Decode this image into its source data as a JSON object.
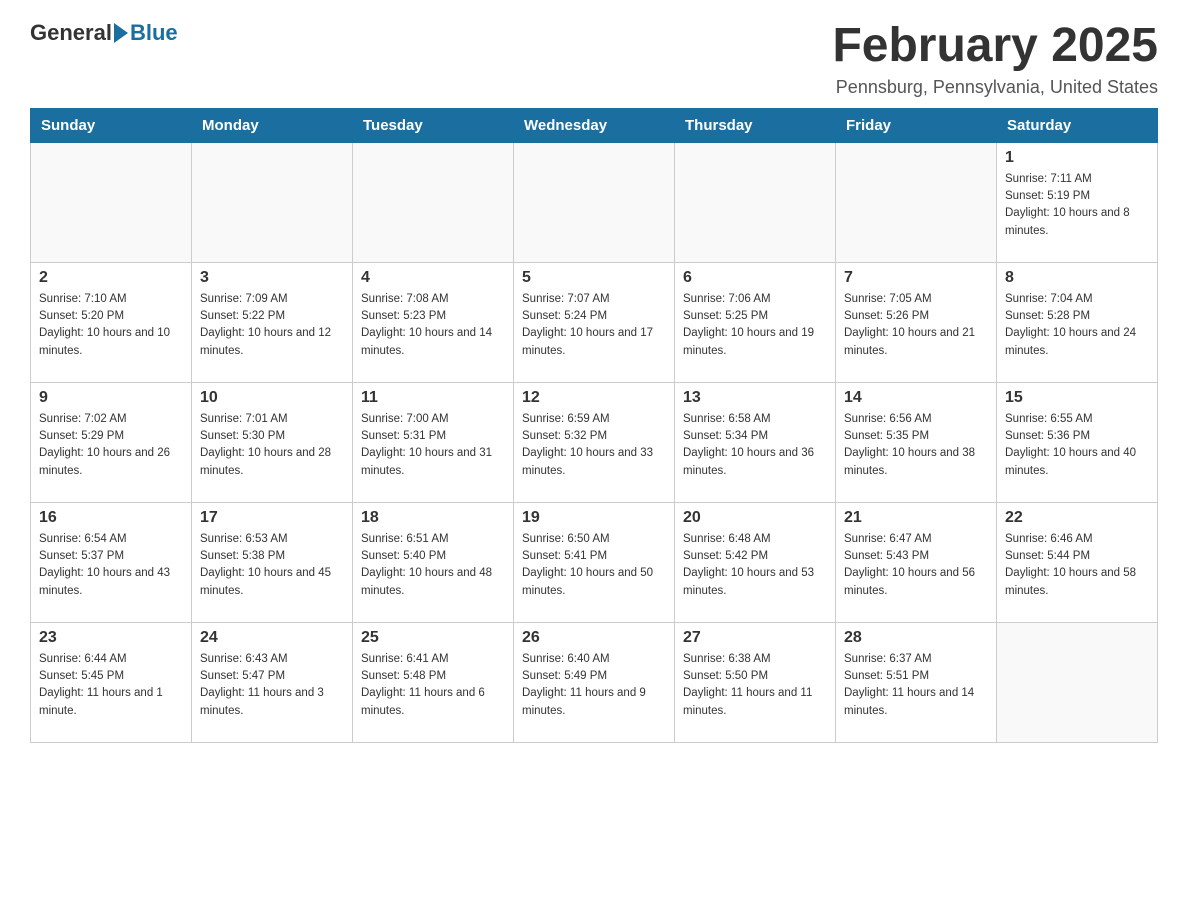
{
  "logo": {
    "general": "General",
    "blue": "Blue"
  },
  "title": "February 2025",
  "subtitle": "Pennsburg, Pennsylvania, United States",
  "days_of_week": [
    "Sunday",
    "Monday",
    "Tuesday",
    "Wednesday",
    "Thursday",
    "Friday",
    "Saturday"
  ],
  "weeks": [
    [
      {
        "day": "",
        "info": ""
      },
      {
        "day": "",
        "info": ""
      },
      {
        "day": "",
        "info": ""
      },
      {
        "day": "",
        "info": ""
      },
      {
        "day": "",
        "info": ""
      },
      {
        "day": "",
        "info": ""
      },
      {
        "day": "1",
        "info": "Sunrise: 7:11 AM\nSunset: 5:19 PM\nDaylight: 10 hours and 8 minutes."
      }
    ],
    [
      {
        "day": "2",
        "info": "Sunrise: 7:10 AM\nSunset: 5:20 PM\nDaylight: 10 hours and 10 minutes."
      },
      {
        "day": "3",
        "info": "Sunrise: 7:09 AM\nSunset: 5:22 PM\nDaylight: 10 hours and 12 minutes."
      },
      {
        "day": "4",
        "info": "Sunrise: 7:08 AM\nSunset: 5:23 PM\nDaylight: 10 hours and 14 minutes."
      },
      {
        "day": "5",
        "info": "Sunrise: 7:07 AM\nSunset: 5:24 PM\nDaylight: 10 hours and 17 minutes."
      },
      {
        "day": "6",
        "info": "Sunrise: 7:06 AM\nSunset: 5:25 PM\nDaylight: 10 hours and 19 minutes."
      },
      {
        "day": "7",
        "info": "Sunrise: 7:05 AM\nSunset: 5:26 PM\nDaylight: 10 hours and 21 minutes."
      },
      {
        "day": "8",
        "info": "Sunrise: 7:04 AM\nSunset: 5:28 PM\nDaylight: 10 hours and 24 minutes."
      }
    ],
    [
      {
        "day": "9",
        "info": "Sunrise: 7:02 AM\nSunset: 5:29 PM\nDaylight: 10 hours and 26 minutes."
      },
      {
        "day": "10",
        "info": "Sunrise: 7:01 AM\nSunset: 5:30 PM\nDaylight: 10 hours and 28 minutes."
      },
      {
        "day": "11",
        "info": "Sunrise: 7:00 AM\nSunset: 5:31 PM\nDaylight: 10 hours and 31 minutes."
      },
      {
        "day": "12",
        "info": "Sunrise: 6:59 AM\nSunset: 5:32 PM\nDaylight: 10 hours and 33 minutes."
      },
      {
        "day": "13",
        "info": "Sunrise: 6:58 AM\nSunset: 5:34 PM\nDaylight: 10 hours and 36 minutes."
      },
      {
        "day": "14",
        "info": "Sunrise: 6:56 AM\nSunset: 5:35 PM\nDaylight: 10 hours and 38 minutes."
      },
      {
        "day": "15",
        "info": "Sunrise: 6:55 AM\nSunset: 5:36 PM\nDaylight: 10 hours and 40 minutes."
      }
    ],
    [
      {
        "day": "16",
        "info": "Sunrise: 6:54 AM\nSunset: 5:37 PM\nDaylight: 10 hours and 43 minutes."
      },
      {
        "day": "17",
        "info": "Sunrise: 6:53 AM\nSunset: 5:38 PM\nDaylight: 10 hours and 45 minutes."
      },
      {
        "day": "18",
        "info": "Sunrise: 6:51 AM\nSunset: 5:40 PM\nDaylight: 10 hours and 48 minutes."
      },
      {
        "day": "19",
        "info": "Sunrise: 6:50 AM\nSunset: 5:41 PM\nDaylight: 10 hours and 50 minutes."
      },
      {
        "day": "20",
        "info": "Sunrise: 6:48 AM\nSunset: 5:42 PM\nDaylight: 10 hours and 53 minutes."
      },
      {
        "day": "21",
        "info": "Sunrise: 6:47 AM\nSunset: 5:43 PM\nDaylight: 10 hours and 56 minutes."
      },
      {
        "day": "22",
        "info": "Sunrise: 6:46 AM\nSunset: 5:44 PM\nDaylight: 10 hours and 58 minutes."
      }
    ],
    [
      {
        "day": "23",
        "info": "Sunrise: 6:44 AM\nSunset: 5:45 PM\nDaylight: 11 hours and 1 minute."
      },
      {
        "day": "24",
        "info": "Sunrise: 6:43 AM\nSunset: 5:47 PM\nDaylight: 11 hours and 3 minutes."
      },
      {
        "day": "25",
        "info": "Sunrise: 6:41 AM\nSunset: 5:48 PM\nDaylight: 11 hours and 6 minutes."
      },
      {
        "day": "26",
        "info": "Sunrise: 6:40 AM\nSunset: 5:49 PM\nDaylight: 11 hours and 9 minutes."
      },
      {
        "day": "27",
        "info": "Sunrise: 6:38 AM\nSunset: 5:50 PM\nDaylight: 11 hours and 11 minutes."
      },
      {
        "day": "28",
        "info": "Sunrise: 6:37 AM\nSunset: 5:51 PM\nDaylight: 11 hours and 14 minutes."
      },
      {
        "day": "",
        "info": ""
      }
    ]
  ]
}
